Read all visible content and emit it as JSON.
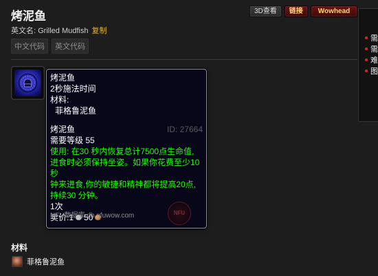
{
  "header": {
    "title": "烤泥鱼",
    "en_label": "英文名:",
    "en_name": "Grilled Mudfish",
    "copy_label": "复制",
    "code_buttons": [
      "中文代码",
      "英文代码"
    ],
    "buttons": {
      "view3d": "3D查看",
      "link": "链接",
      "wowhead": "Wowhead"
    }
  },
  "right_panel": {
    "items": [
      "需要",
      "需要",
      "难度",
      "图标"
    ]
  },
  "tooltip": {
    "spell_name": "烤泥鱼",
    "cast_time": "2秒施法时间",
    "reagents_label": "材料:",
    "reagent": "菲格鲁泥鱼",
    "item_name": "烤泥鱼",
    "item_id": "ID: 27664",
    "required_level": "需要等级 55",
    "use_line1": "使用:  在30 秒内恢复总计7500点生命值,",
    "use_line2": "进食时必须保持坐姿。如果你花费至少10秒",
    "use_line3": "钟来进食,你的敏捷和精神都将提高20点,",
    "use_line4": "持续30 分钟。",
    "stack": "1次",
    "sell_label": "卖价:",
    "sell_silver": "1",
    "sell_copper": "50",
    "footer": "NFU数据库 db.nfuwow.com",
    "badge": "NFU"
  },
  "materials": {
    "title": "材料",
    "items": [
      "菲格鲁泥鱼"
    ]
  }
}
